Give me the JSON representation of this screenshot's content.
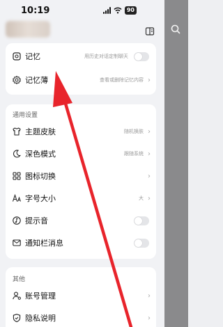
{
  "status": {
    "time": "10:19",
    "battery": "90"
  },
  "memory_card": {
    "items": [
      {
        "label": "记忆",
        "hint": "用历史对话定制聊天",
        "control": "toggle"
      },
      {
        "label": "记忆薄",
        "hint": "查看或删除记忆内容",
        "control": "chevron"
      }
    ]
  },
  "general": {
    "title": "通用设置",
    "items": [
      {
        "label": "主题皮肤",
        "hint": "随机换肤",
        "control": "chevron"
      },
      {
        "label": "深色模式",
        "hint": "跟随系统",
        "control": "chevron"
      },
      {
        "label": "图标切换",
        "hint": "",
        "control": "chevron"
      },
      {
        "label": "字号大小",
        "hint": "大",
        "control": "chevron"
      },
      {
        "label": "提示音",
        "hint": "",
        "control": "toggle"
      },
      {
        "label": "通知栏消息",
        "hint": "",
        "control": "toggle"
      }
    ]
  },
  "other": {
    "title": "其他",
    "items": [
      {
        "label": "账号管理",
        "control": "chevron"
      },
      {
        "label": "隐私说明",
        "control": "chevron"
      }
    ]
  },
  "icons": {
    "header_right": "book-icon",
    "underlay": "search-icon"
  },
  "colors": {
    "annotation_arrow": "#e8242b",
    "panel_bg": "#f1f2f5",
    "card_bg": "#ffffff"
  }
}
